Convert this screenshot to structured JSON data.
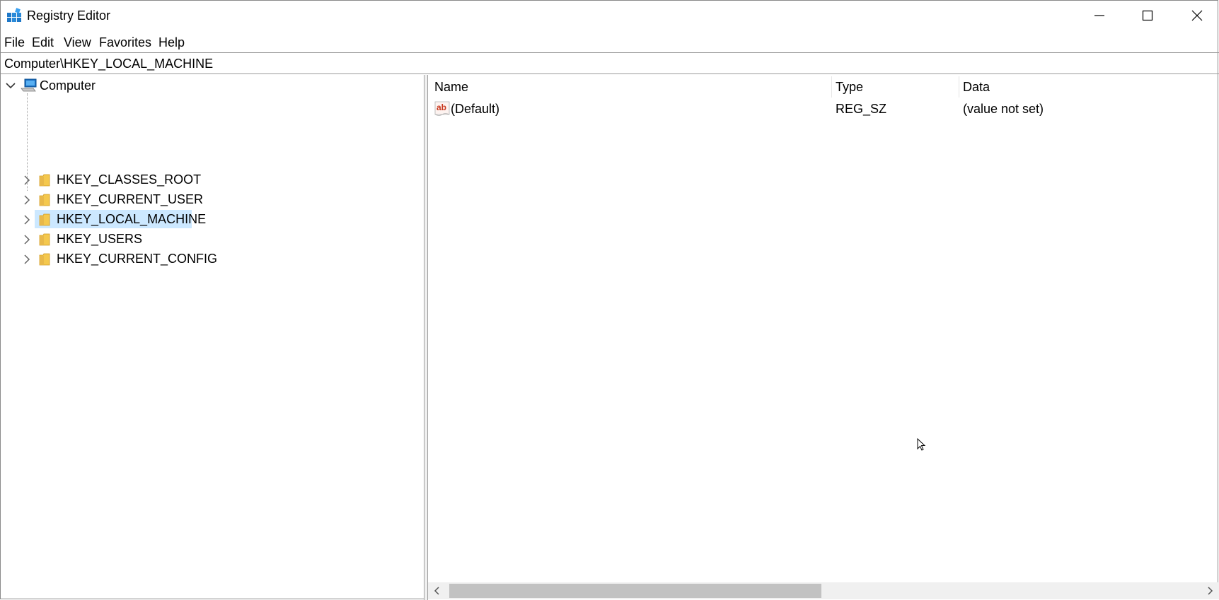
{
  "window": {
    "title": "Registry Editor",
    "app_icon": "registry-editor-icon",
    "controls": [
      "minimize-icon",
      "maximize-icon",
      "close-icon"
    ]
  },
  "menu": {
    "items": [
      {
        "label": "File"
      },
      {
        "label": "Edit"
      },
      {
        "label": "View"
      },
      {
        "label": "Favorites"
      },
      {
        "label": "Help"
      }
    ]
  },
  "address": {
    "path": "Computer\\HKEY_LOCAL_MACHINE"
  },
  "tree": {
    "root": {
      "label": "Computer",
      "icon": "computer-icon",
      "expanded": true
    },
    "keys": [
      {
        "label": "HKEY_CLASSES_ROOT",
        "selected": false
      },
      {
        "label": "HKEY_CURRENT_USER",
        "selected": false
      },
      {
        "label": "HKEY_LOCAL_MACHINE",
        "selected": true
      },
      {
        "label": "HKEY_USERS",
        "selected": false
      },
      {
        "label": "HKEY_CURRENT_CONFIG",
        "selected": false
      }
    ]
  },
  "list": {
    "columns": [
      {
        "label": "Name"
      },
      {
        "label": "Type"
      },
      {
        "label": "Data"
      }
    ],
    "rows": [
      {
        "name": "(Default)",
        "type": "REG_SZ",
        "data": "(value not set)",
        "icon": "string-value-icon"
      }
    ]
  },
  "colors": {
    "selection": "#cce8ff",
    "folder": "#e8b84a",
    "scrollbar_thumb": "#c2c2c2"
  }
}
